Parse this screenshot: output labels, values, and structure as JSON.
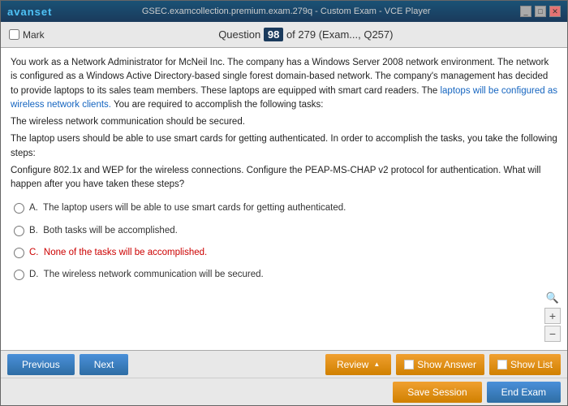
{
  "titleBar": {
    "logo": "avanset",
    "title": "GSEC.examcollection.premium.exam.279q - Custom Exam - VCE Player",
    "controls": [
      "minimize",
      "maximize",
      "close"
    ]
  },
  "toolbar": {
    "markLabel": "Mark",
    "questionLabel": "Question",
    "questionNumber": "98",
    "questionTotal": "of 279 (Exam..., Q257)"
  },
  "question": {
    "text1": "You work as a Network Administrator for McNeil Inc. The company has a Windows Server 2008 network environment. The network is configured as a Windows Active Directory-based single forest domain-based network. The company's management has decided to provide laptops to its sales team members. These laptops are equipped with smart card readers. The laptops will be configured as wireless network clients. You are required to accomplish the following tasks:",
    "text2": "The wireless network communication should be secured.",
    "text3": "The laptop users should be able to use smart cards for getting authenticated. In order to accomplish the tasks, you take the following steps:",
    "text4": "Configure 802.1x and WEP for the wireless connections. Configure the PEAP-MS-CHAP v2 protocol for authentication. What will happen after you have taken these steps?",
    "options": [
      {
        "id": "A",
        "text": "The laptop users will be able to use smart cards for getting authenticated.",
        "color": "normal"
      },
      {
        "id": "B",
        "text": "Both tasks will be accomplished.",
        "color": "normal"
      },
      {
        "id": "C",
        "text": "None of the tasks will be accomplished.",
        "color": "red"
      },
      {
        "id": "D",
        "text": "The wireless network communication will be secured.",
        "color": "normal"
      }
    ]
  },
  "bottomBar1": {
    "previousLabel": "Previous",
    "nextLabel": "Next",
    "reviewLabel": "Review",
    "showAnswerLabel": "Show Answer",
    "showListLabel": "Show List"
  },
  "bottomBar2": {
    "saveSessionLabel": "Save Session",
    "endExamLabel": "End Exam"
  },
  "zoom": {
    "searchIcon": "🔍",
    "plusIcon": "+",
    "minusIcon": "−"
  }
}
